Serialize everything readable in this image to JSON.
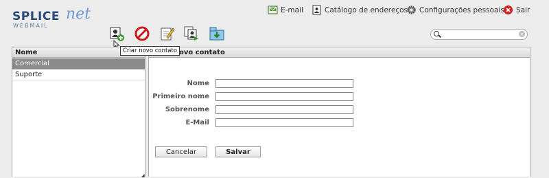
{
  "logo": {
    "main": "SPLICE",
    "accent": "net",
    "sub": "WEBMAIL"
  },
  "topnav": {
    "email": "E-mail",
    "addressbook": "Catálogo de endereços",
    "settings": "Configurações pessoais",
    "logout": "Sair"
  },
  "toolbar": {
    "tooltip": "Criar novo contato",
    "buttons": [
      "add-contact-icon",
      "delete-icon",
      "edit-icon",
      "copy-contact-icon",
      "export-icon"
    ]
  },
  "search": {
    "value": "",
    "placeholder": ""
  },
  "groups": {
    "header": "Nome",
    "items": [
      {
        "label": "Comercial",
        "selected": true
      },
      {
        "label": "Suporte",
        "selected": false
      }
    ]
  },
  "form": {
    "title": "Criar novo contato",
    "fields": [
      {
        "label": "Nome",
        "value": ""
      },
      {
        "label": "Primeiro nome",
        "value": ""
      },
      {
        "label": "Sobrenome",
        "value": ""
      },
      {
        "label": "E-Mail",
        "value": ""
      }
    ],
    "cancel": "Cancelar",
    "save": "Salvar"
  },
  "colors": {
    "accent": "#2a4a7a",
    "selected_row": "#8a8a8a",
    "delete_red": "#cc1a1a"
  }
}
